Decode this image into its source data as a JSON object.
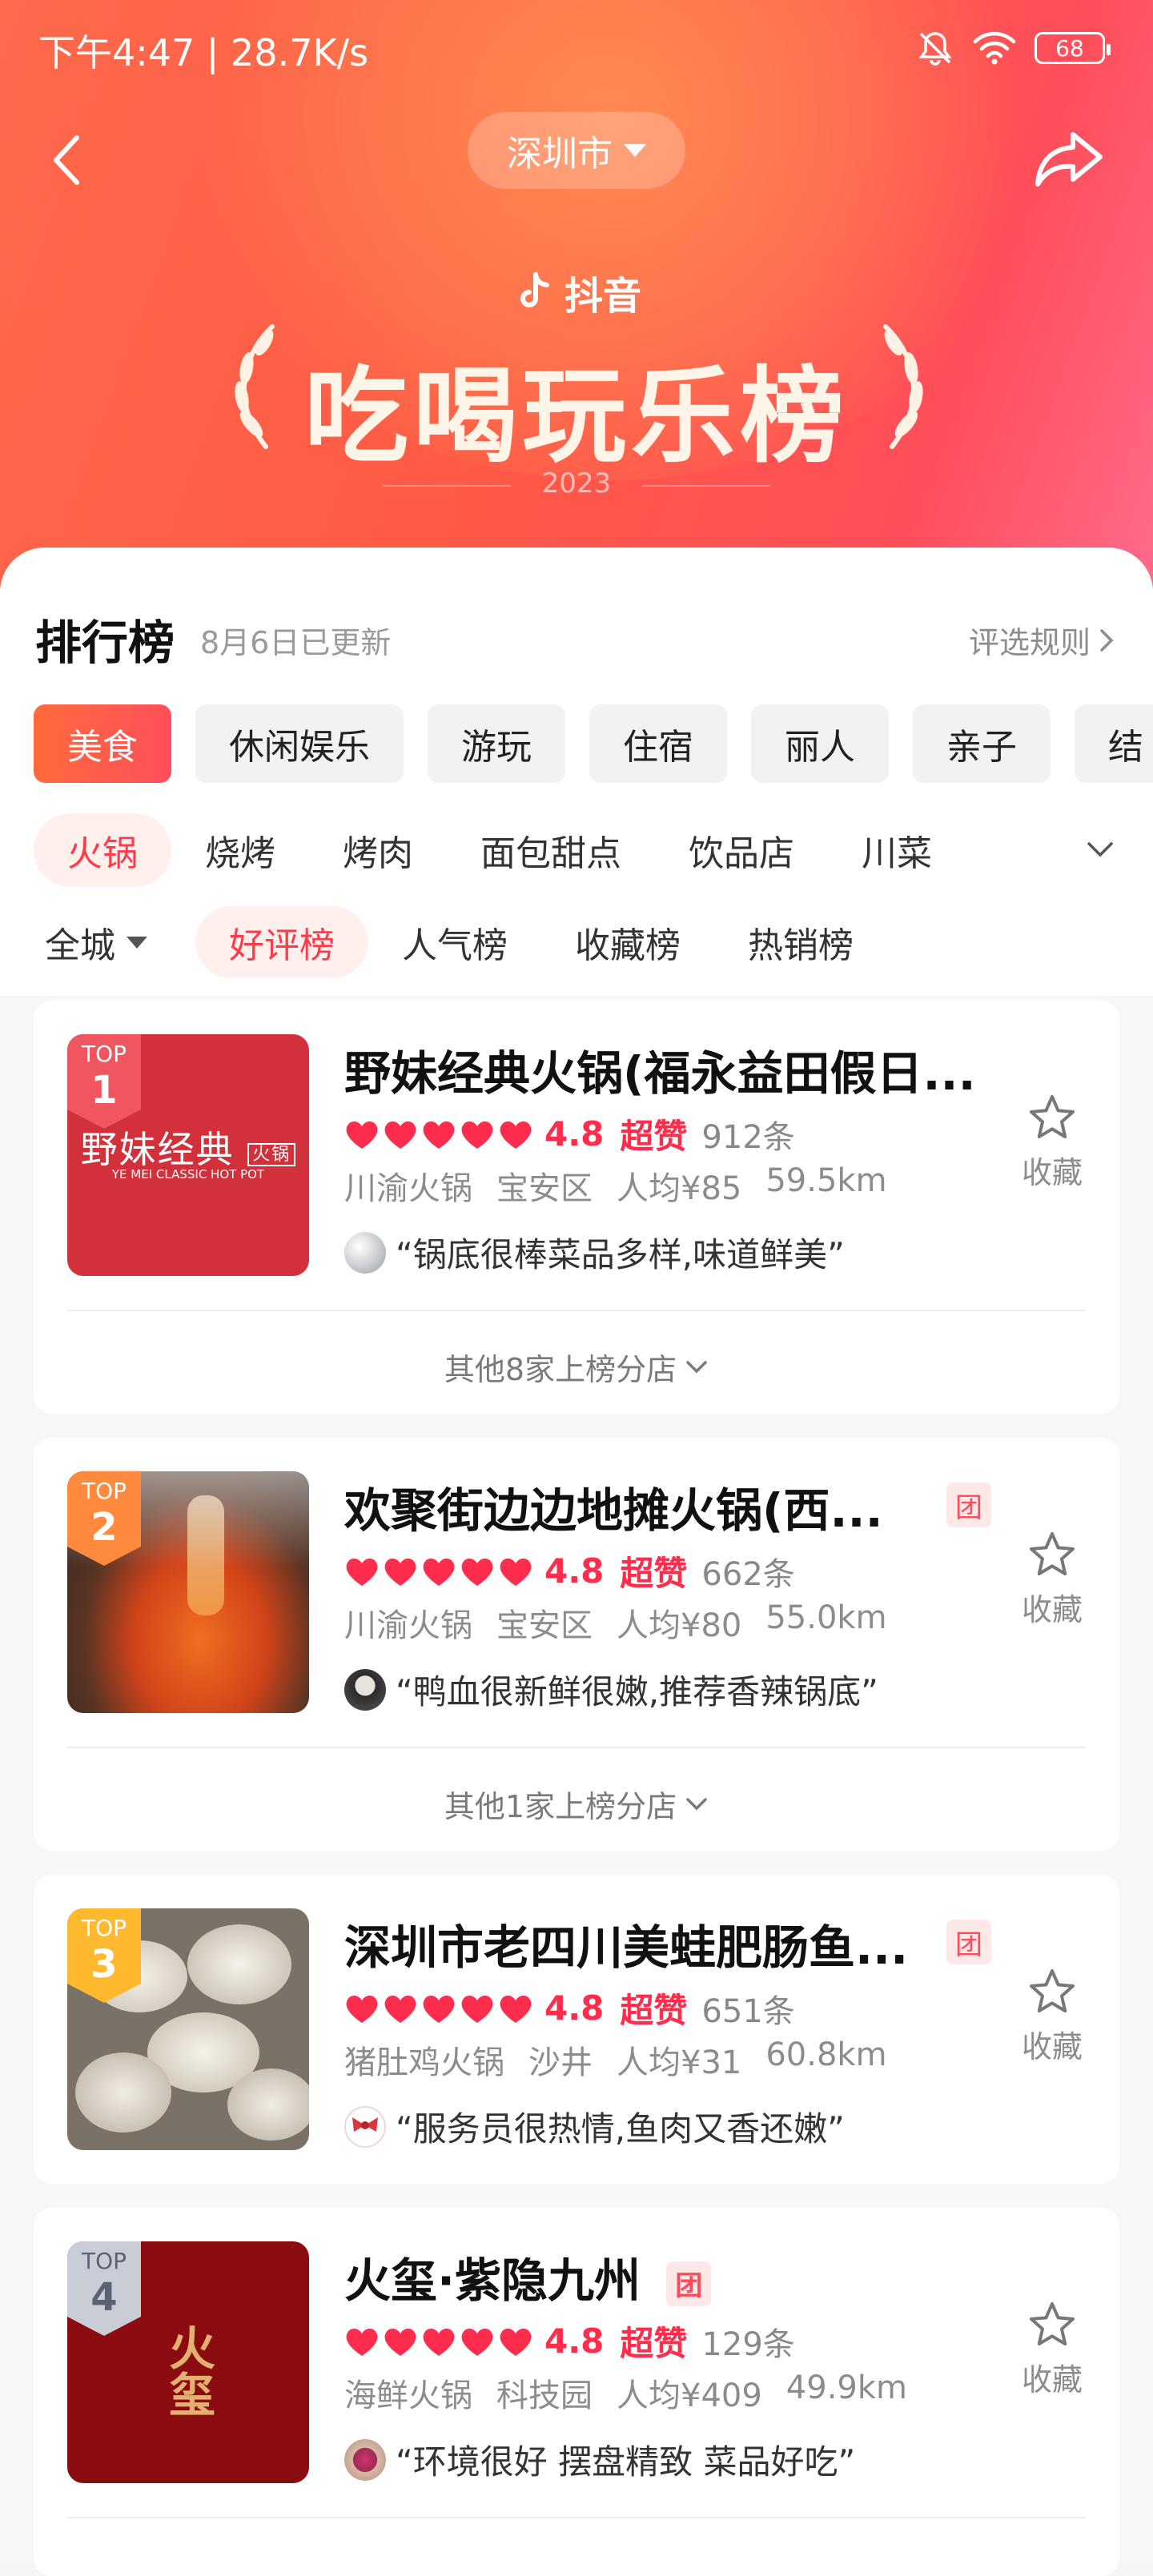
{
  "status_bar": {
    "time": "下午4:47 | 28.7K/s",
    "battery": "68"
  },
  "header": {
    "city": "深圳市",
    "brand": "抖音",
    "title": "吃喝玩乐榜",
    "year": "2023"
  },
  "ranking": {
    "title": "排行榜",
    "updated": "8月6日已更新",
    "rules_link": "评选规则"
  },
  "categories": [
    {
      "label": "美食"
    },
    {
      "label": "休闲娱乐"
    },
    {
      "label": "游玩"
    },
    {
      "label": "住宿"
    },
    {
      "label": "丽人"
    },
    {
      "label": "亲子"
    },
    {
      "label": "结"
    }
  ],
  "subcategories": [
    {
      "label": "火锅"
    },
    {
      "label": "烧烤"
    },
    {
      "label": "烤肉"
    },
    {
      "label": "面包甜点"
    },
    {
      "label": "饮品店"
    },
    {
      "label": "川菜"
    }
  ],
  "filters": {
    "city": "全城",
    "tabs": [
      {
        "label": "好评榜"
      },
      {
        "label": "人气榜"
      },
      {
        "label": "收藏榜"
      },
      {
        "label": "热销榜"
      }
    ]
  },
  "shops": [
    {
      "rank_top": "TOP",
      "rank": "1",
      "name": "野妹经典火锅(福永益田假日...",
      "score": "4.8",
      "praise": "超赞",
      "count": "912条",
      "cuisine": "川渝火锅",
      "district": "宝安区",
      "price": "人均¥85",
      "distance": "59.5km",
      "quote": "“锅底很棒菜品多样,味道鲜美”",
      "fav": "收藏",
      "branches": "其他8家上榜分店",
      "thumb_logo": "野妹经典",
      "thumb_logo_tag": "火锅",
      "thumb_sub": "YE MEI CLASSIC HOT POT"
    },
    {
      "rank_top": "TOP",
      "rank": "2",
      "name": "欢聚街边边地摊火锅(西...",
      "group": "团",
      "score": "4.8",
      "praise": "超赞",
      "count": "662条",
      "cuisine": "川渝火锅",
      "district": "宝安区",
      "price": "人均¥80",
      "distance": "55.0km",
      "quote": "“鸭血很新鲜很嫩,推荐香辣锅底”",
      "fav": "收藏",
      "branches": "其他1家上榜分店"
    },
    {
      "rank_top": "TOP",
      "rank": "3",
      "name": "深圳市老四川美蛙肥肠鱼...",
      "group": "团",
      "score": "4.8",
      "praise": "超赞",
      "count": "651条",
      "cuisine": "猪肚鸡火锅",
      "district": "沙井",
      "price": "人均¥31",
      "distance": "60.8km",
      "quote": "“服务员很热情,鱼肉又香还嫩”",
      "fav": "收藏"
    },
    {
      "rank_top": "TOP",
      "rank": "4",
      "name": "火玺·紫隐九州",
      "group": "团",
      "score": "4.8",
      "praise": "超赞",
      "count": "129条",
      "cuisine": "海鲜火锅",
      "district": "科技园",
      "price": "人均¥409",
      "distance": "49.9km",
      "quote": "“环境很好 摆盘精致 菜品好吃”",
      "fav": "收藏",
      "thumb_logo": "火玺"
    }
  ],
  "colors": {
    "accent": "#ff3b4a",
    "header_start": "#fd6a4c",
    "header_end": "#ff6b8c",
    "rank1": "#f0565f",
    "rank2": "#ff8a3d",
    "rank3": "#ffb92e",
    "rank4": "#c9cdd6"
  }
}
